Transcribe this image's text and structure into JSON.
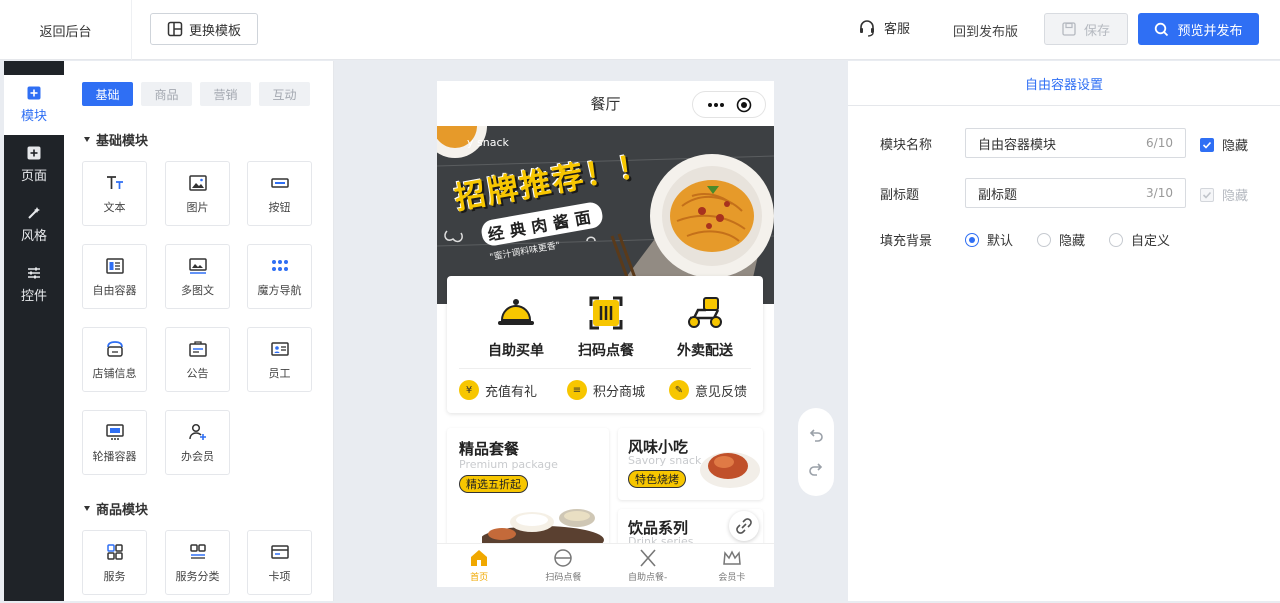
{
  "topbar": {
    "back_label": "返回后台",
    "template_label": "更换模板",
    "service_label": "客服",
    "revert_label": "回到发布版",
    "save_label": "保存",
    "publish_label": "预览并发布"
  },
  "nav": [
    {
      "label": "模块",
      "icon": "plus-square-icon"
    },
    {
      "label": "页面",
      "icon": "plus-square-icon"
    },
    {
      "label": "风格",
      "icon": "magic-wand-icon"
    },
    {
      "label": "控件",
      "icon": "sliders-icon"
    }
  ],
  "components": {
    "tabs": [
      "基础",
      "商品",
      "营销",
      "互动"
    ],
    "basic_title": "基础模块",
    "basic_items": [
      "文本",
      "图片",
      "按钮",
      "自由容器",
      "多图文",
      "魔方导航",
      "店铺信息",
      "公告",
      "员工",
      "轮播容器",
      "办会员"
    ],
    "goods_title": "商品模块",
    "goods_items": [
      "服务",
      "服务分类",
      "卡项"
    ]
  },
  "phone": {
    "title": "餐厅",
    "banner": {
      "corner": "y snack",
      "headline": "招牌推荐！！",
      "subline": "经典肉酱面",
      "tagline": "\"蜜汁调料味更香\""
    },
    "main_icons": [
      "自助买单",
      "扫码点餐",
      "外卖配送"
    ],
    "sub_icons": [
      "充值有礼",
      "积分商城",
      "意见反馈"
    ],
    "tile_set": {
      "title": "精品套餐",
      "en": "Premium package",
      "pill": "精选五折起"
    },
    "tile_snack": {
      "title": "风味小吃",
      "en": "Savory snack",
      "pill": "特色烧烤"
    },
    "tile_drink": {
      "title": "饮品系列",
      "en": "Drink series"
    },
    "tabbar": [
      "首页",
      "扫码点餐",
      "自助点餐-",
      "会员卡"
    ]
  },
  "settings": {
    "title": "自由容器设置",
    "name_label": "模块名称",
    "name_value": "自由容器模块",
    "name_count": "6/10",
    "name_hide": "隐藏",
    "sub_label": "副标题",
    "sub_value": "副标题",
    "sub_count": "3/10",
    "sub_hide": "隐藏",
    "bg_label": "填充背景",
    "bg_options": [
      "默认",
      "隐藏",
      "自定义"
    ]
  },
  "colors": {
    "accent": "#2f6ff4",
    "yellow": "#f7c600",
    "dark": "#1f2328"
  }
}
